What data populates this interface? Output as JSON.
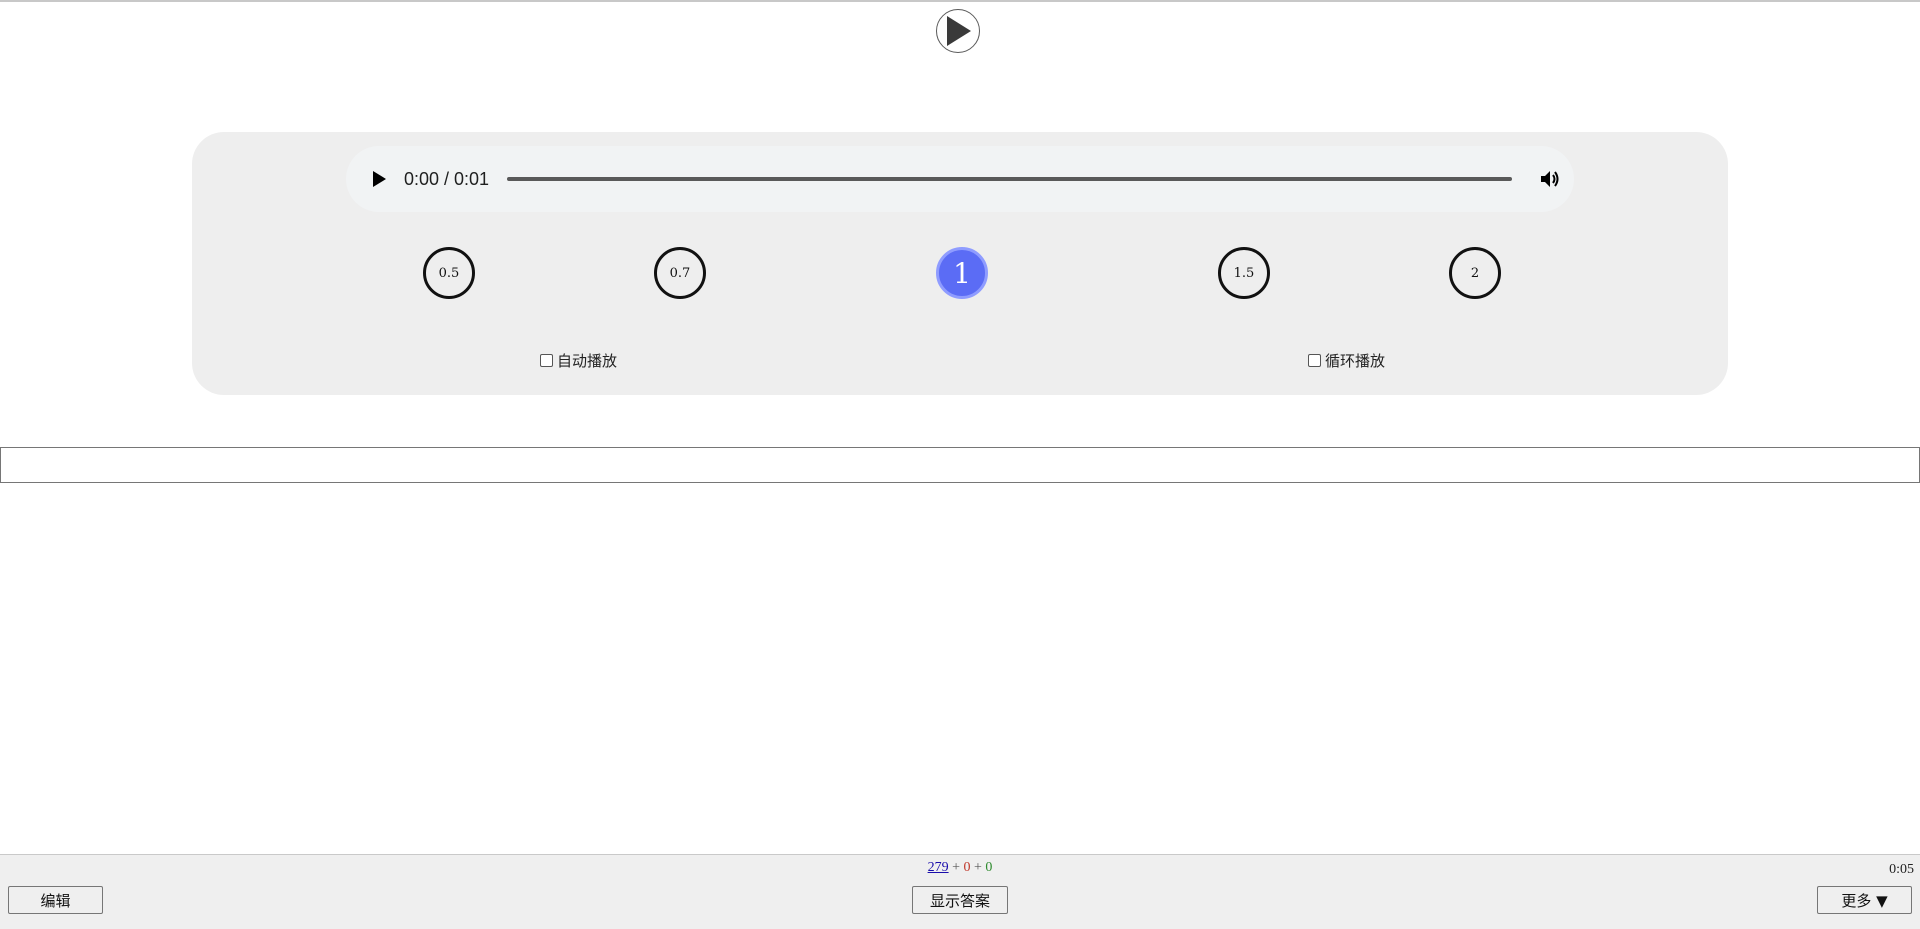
{
  "audio": {
    "time_display": "0:00 / 0:01"
  },
  "speed": {
    "options": [
      "0.5",
      "0.7",
      "1",
      "1.5",
      "2"
    ],
    "selected": "1"
  },
  "options": {
    "autoplay_label": "自动播放",
    "loop_label": "循环播放"
  },
  "answer": {
    "value": "",
    "placeholder": ""
  },
  "footer": {
    "count_new": "279",
    "count_separator_1": "+",
    "count_learn": "0",
    "count_separator_2": "+",
    "count_review": "0",
    "timer": "0:05",
    "edit_label": "编辑",
    "show_answer_label": "显示答案",
    "more_label": "更多 ▼"
  }
}
